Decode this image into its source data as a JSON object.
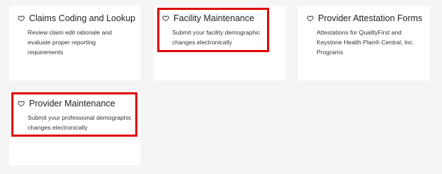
{
  "cards": [
    {
      "title": "Claims Coding and Lookup",
      "description_line1": "Review claim edit rationale and",
      "description_line2": "evaluate proper reporting requirements",
      "description_line3": "",
      "icon": "heart-outline-icon"
    },
    {
      "title": "Facility Maintenance",
      "description_line1": "Submit your facility demographic",
      "description_line2": "changes electronically",
      "description_line3": "",
      "icon": "heart-outline-icon"
    },
    {
      "title": "Provider Attestation Forms",
      "description_line1": "Attestations for QualityFirst and",
      "description_line2": "Keystone Health Plan® Central, Inc.",
      "description_line3": "Programs",
      "icon": "heart-outline-icon"
    },
    {
      "title": "Provider Maintenance",
      "description_line1": "Submit your professional demographic",
      "description_line2": "changes electronically",
      "description_line3": "",
      "icon": "heart-outline-icon"
    }
  ],
  "colors": {
    "highlight": "#e00000",
    "background": "#f5f5f5",
    "card": "#ffffff"
  }
}
